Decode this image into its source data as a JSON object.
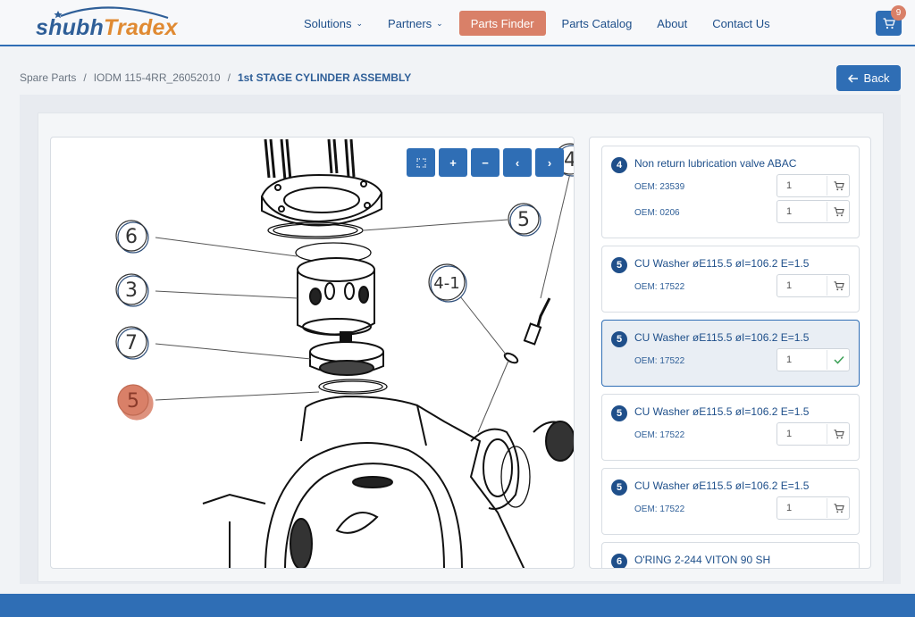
{
  "logo": {
    "part1": "shubh",
    "part2": "Tradex"
  },
  "nav": [
    {
      "label": "Solutions",
      "has_dropdown": true
    },
    {
      "label": "Partners",
      "has_dropdown": true
    },
    {
      "label": "Parts Finder",
      "active": true
    },
    {
      "label": "Parts Catalog"
    },
    {
      "label": "About"
    },
    {
      "label": "Contact Us"
    }
  ],
  "cart": {
    "count": "9",
    "icon": "cart-icon"
  },
  "breadcrumb": [
    "Spare Parts",
    "IODM 115-4RR_26052010",
    "1st STAGE CYLINDER ASSEMBLY"
  ],
  "back_label": "Back",
  "toolbar": {
    "fullscreen": "fullscreen-icon",
    "zoom_in": "+",
    "zoom_out": "−",
    "prev": "‹",
    "next": "›"
  },
  "diagram": {
    "callouts": [
      "6",
      "3",
      "7",
      "5",
      "5",
      "4-1",
      "4"
    ],
    "highlighted_callout": "5"
  },
  "parts": [
    {
      "num": "4",
      "title": "Non return lubrication valve ABAC",
      "oems": [
        {
          "label": "OEM: 23539",
          "qty": "1"
        },
        {
          "label": "OEM: 0206",
          "qty": "1"
        }
      ]
    },
    {
      "num": "5",
      "title": "CU Washer øE115.5 øI=106.2 E=1.5",
      "oems": [
        {
          "label": "OEM: 17522",
          "qty": "1"
        }
      ]
    },
    {
      "num": "5",
      "title": "CU Washer øE115.5 øI=106.2 E=1.5",
      "selected": true,
      "oems": [
        {
          "label": "OEM: 17522",
          "qty": "1",
          "added": true
        }
      ]
    },
    {
      "num": "5",
      "title": "CU Washer øE115.5 øI=106.2 E=1.5",
      "oems": [
        {
          "label": "OEM: 17522",
          "qty": "1"
        }
      ]
    },
    {
      "num": "5",
      "title": "CU Washer øE115.5 øI=106.2 E=1.5",
      "oems": [
        {
          "label": "OEM: 17522",
          "qty": "1"
        }
      ]
    },
    {
      "num": "6",
      "title": "O'RING 2-244 VITON 90 SH",
      "oems": []
    }
  ],
  "colors": {
    "primary": "#2f6eb5",
    "accent": "#d98068",
    "text_blue": "#1e4f8a"
  }
}
